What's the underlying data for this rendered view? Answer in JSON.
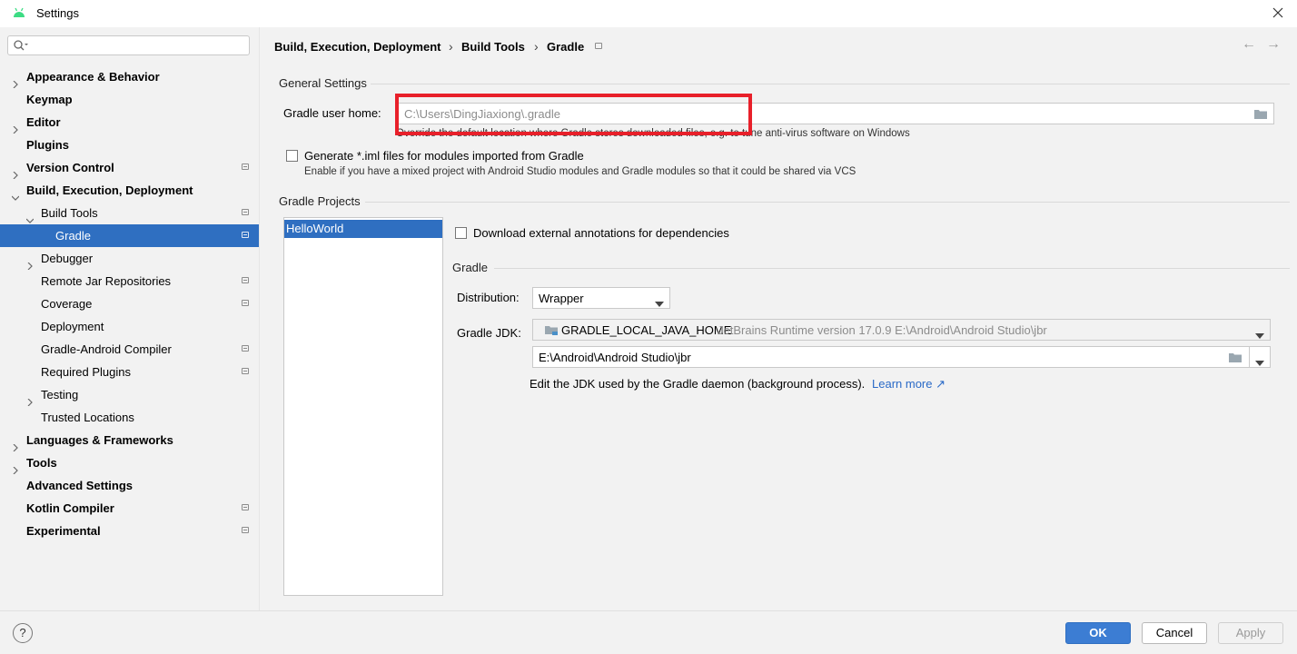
{
  "window": {
    "title": "Settings"
  },
  "sidebar": {
    "search": {
      "value": "",
      "placeholder": ""
    },
    "items": [
      {
        "label": "Appearance & Behavior",
        "level": 0,
        "bold": true,
        "arrow": "collapsed",
        "project_icon": false
      },
      {
        "label": "Keymap",
        "level": 0,
        "bold": true,
        "arrow": "none",
        "project_icon": false
      },
      {
        "label": "Editor",
        "level": 0,
        "bold": true,
        "arrow": "collapsed",
        "project_icon": false
      },
      {
        "label": "Plugins",
        "level": 0,
        "bold": true,
        "arrow": "none",
        "project_icon": false
      },
      {
        "label": "Version Control",
        "level": 0,
        "bold": true,
        "arrow": "collapsed",
        "project_icon": true
      },
      {
        "label": "Build, Execution, Deployment",
        "level": 0,
        "bold": true,
        "arrow": "expanded",
        "project_icon": false
      },
      {
        "label": "Build Tools",
        "level": 1,
        "bold": false,
        "arrow": "expanded",
        "project_icon": true
      },
      {
        "label": "Gradle",
        "level": 2,
        "bold": false,
        "arrow": "none",
        "project_icon": true,
        "selected": true
      },
      {
        "label": "Debugger",
        "level": 1,
        "bold": false,
        "arrow": "collapsed",
        "project_icon": false
      },
      {
        "label": "Remote Jar Repositories",
        "level": 1,
        "bold": false,
        "arrow": "none",
        "project_icon": true
      },
      {
        "label": "Coverage",
        "level": 1,
        "bold": false,
        "arrow": "none",
        "project_icon": true
      },
      {
        "label": "Deployment",
        "level": 1,
        "bold": false,
        "arrow": "none",
        "project_icon": false
      },
      {
        "label": "Gradle-Android Compiler",
        "level": 1,
        "bold": false,
        "arrow": "none",
        "project_icon": true
      },
      {
        "label": "Required Plugins",
        "level": 1,
        "bold": false,
        "arrow": "none",
        "project_icon": true
      },
      {
        "label": "Testing",
        "level": 1,
        "bold": false,
        "arrow": "collapsed",
        "project_icon": false
      },
      {
        "label": "Trusted Locations",
        "level": 1,
        "bold": false,
        "arrow": "none",
        "project_icon": false
      },
      {
        "label": "Languages & Frameworks",
        "level": 0,
        "bold": true,
        "arrow": "collapsed",
        "project_icon": false
      },
      {
        "label": "Tools",
        "level": 0,
        "bold": true,
        "arrow": "collapsed",
        "project_icon": false
      },
      {
        "label": "Advanced Settings",
        "level": 0,
        "bold": true,
        "arrow": "none",
        "project_icon": false
      },
      {
        "label": "Kotlin Compiler",
        "level": 0,
        "bold": true,
        "arrow": "none",
        "project_icon": true
      },
      {
        "label": "Experimental",
        "level": 0,
        "bold": true,
        "arrow": "none",
        "project_icon": true
      }
    ]
  },
  "breadcrumb": {
    "items": [
      "Build, Execution, Deployment",
      "Build Tools",
      "Gradle"
    ],
    "separator": "›"
  },
  "nav": {
    "back": "←",
    "forward": "→"
  },
  "general": {
    "section_title": "General Settings",
    "user_home_label": "Gradle user home:",
    "user_home_value": "C:\\Users\\DingJiaxiong\\.gradle",
    "user_home_hint": "Override the default location where Gradle stores downloaded files, e.g. to tune anti-virus software on Windows",
    "iml_label": "Generate *.iml files for modules imported from Gradle",
    "iml_checked": false,
    "iml_hint": "Enable if you have a mixed project with Android Studio modules and Gradle modules so that it could be shared via VCS"
  },
  "projects": {
    "section_title": "Gradle Projects",
    "list": [
      "HelloWorld"
    ],
    "download_annotations_label": "Download external annotations for dependencies",
    "download_annotations_checked": false,
    "gradle_section_title": "Gradle",
    "distribution_label": "Distribution:",
    "distribution_value": "Wrapper",
    "jdk_label": "Gradle JDK:",
    "jdk_name": "GRADLE_LOCAL_JAVA_HOME",
    "jdk_detail": "JetBrains Runtime version 17.0.9 E:\\Android\\Android Studio\\jbr",
    "jdk_path": "E:\\Android\\Android Studio\\jbr",
    "jdk_hint": "Edit the JDK used by the Gradle daemon (background process).",
    "learn_more": "Learn more ↗"
  },
  "footer": {
    "help": "?",
    "ok": "OK",
    "cancel": "Cancel",
    "apply": "Apply"
  },
  "colors": {
    "accent": "#2f6fc1",
    "highlight_box": "#e8202a",
    "link": "#2a6ac7"
  },
  "icons": [
    "android-icon",
    "close-icon",
    "search-icon",
    "project-scope-icon",
    "folder-icon",
    "dropdown-arrow-icon",
    "help-icon"
  ]
}
